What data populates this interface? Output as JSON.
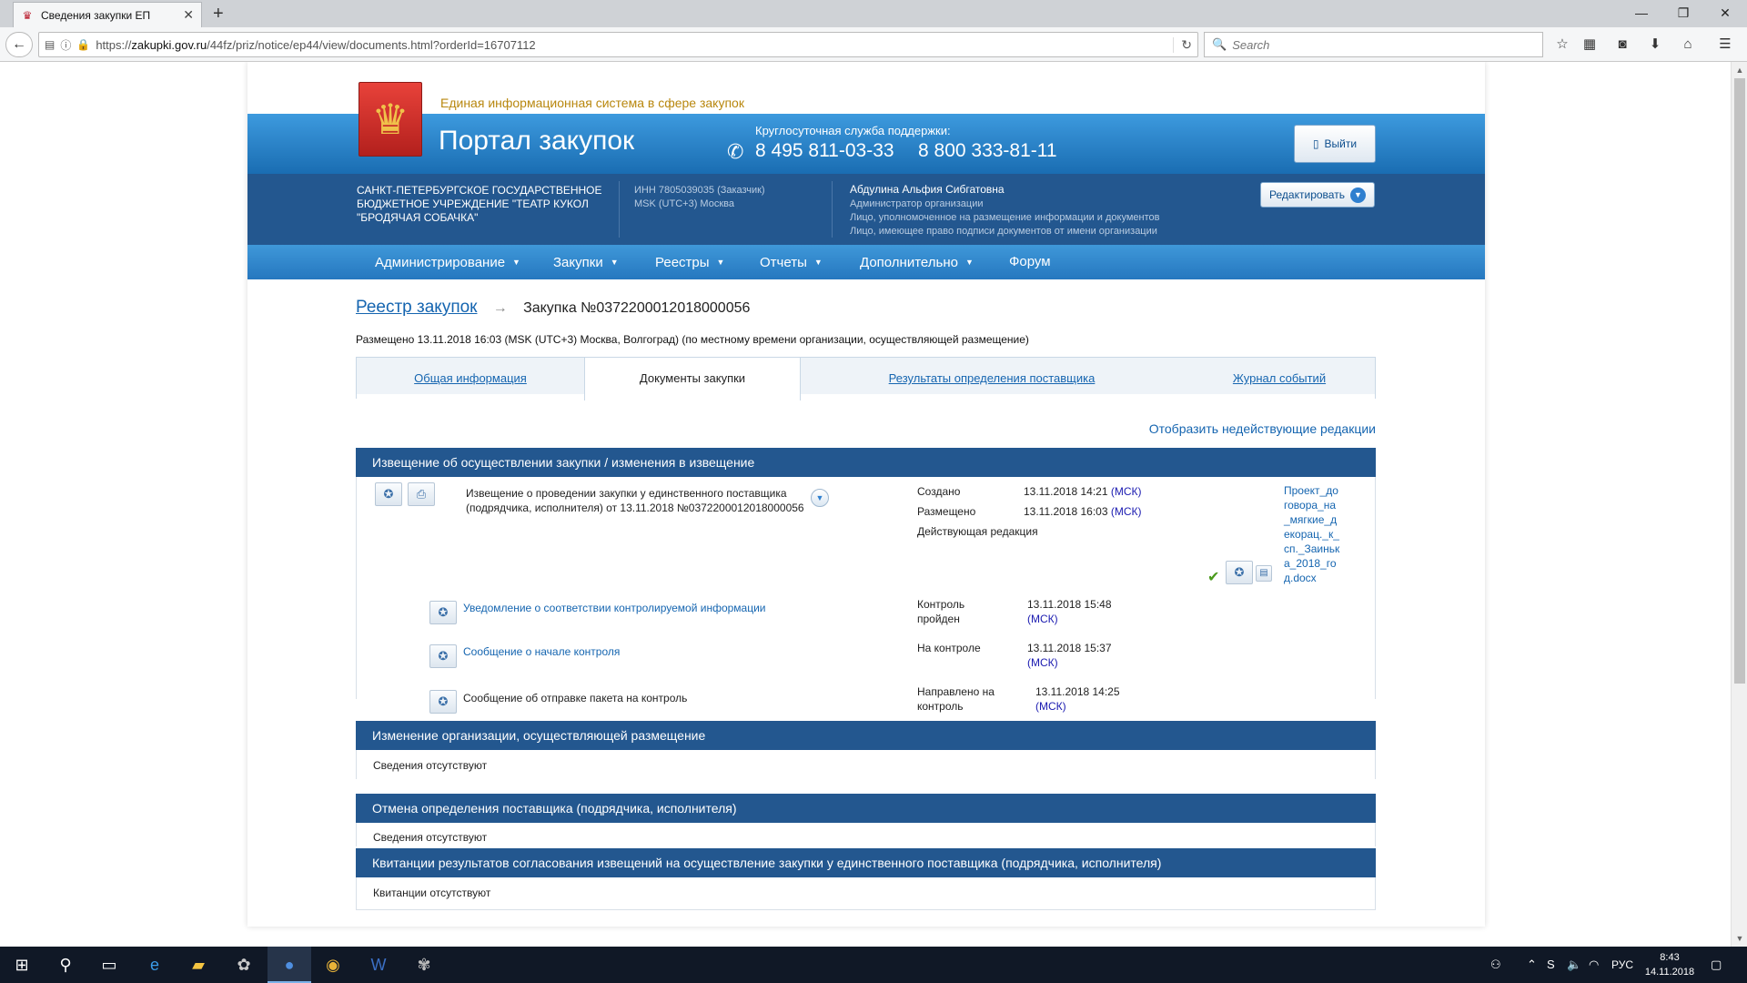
{
  "browser": {
    "tab_title": "Сведения закупки ЕП",
    "url_prefix": "https://",
    "url_host": "zakupki.gov.ru",
    "url_path": "/44fz/priz/notice/ep44/view/documents.html?orderId=16707112",
    "search_placeholder": "Search"
  },
  "header": {
    "tagline": "Единая информационная система в сфере закупок",
    "portal_title": "Портал закупок",
    "support_label": "Круглосуточная служба поддержки:",
    "phone1": "8 495 811-03-33",
    "phone2": "8 800 333-81-11",
    "logout_label": "Выйти"
  },
  "org": {
    "name": "Санкт-Петербургское государственное бюджетное учреждение \"Театр кукол \"Бродячая собачка\"",
    "inn": "ИНН 7805039035 (Заказчик)",
    "tz": "MSK (UTC+3) Москва",
    "user_name": "Абдулина Альфия Сибгатовна",
    "roles": [
      "Администратор организации",
      "Лицо, уполномоченное на размещение информации и документов",
      "Лицо, имеющее право подписи документов от имени организации"
    ],
    "edit_label": "Редактировать"
  },
  "menu": [
    "Администрирование",
    "Закупки",
    "Реестры",
    "Отчеты",
    "Дополнительно",
    "Форум"
  ],
  "breadcrumb": {
    "registry": "Реестр закупок",
    "current": "Закупка №0372200012018000056"
  },
  "placed_text": "Размещено 13.11.2018 16:03 (MSK (UTC+3) Москва, Волгоград) (по местному времени организации, осуществляющей размещение)",
  "tabs": [
    "Общая информация",
    "Документы закупки",
    "Результаты определения поставщика",
    "Журнал событий"
  ],
  "show_inactive": "Отобразить недействующие редакции",
  "sections": {
    "notice": {
      "title": "Извещение об осуществлении закупки / изменения в извещение",
      "doc_title": "Извещение о проведении закупки у единственного поставщика (подрядчика, исполнителя) от 13.11.2018 №0372200012018000056",
      "created_label": "Создано",
      "created_value": "13.11.2018 14:21",
      "placed_label": "Размещено",
      "placed_value": "13.11.2018 16:03",
      "msk": "(МСК)",
      "current_edition": "Действующая редакция",
      "file_name": "Проект_договора_на_мягкие_декорац._к_сп._Заинька_2018_год.docx",
      "control": [
        {
          "text": "Уведомление о соответствии контролируемой информации",
          "link": true,
          "label": "Контроль пройден",
          "value": "13.11.2018 15:48"
        },
        {
          "text": "Сообщение о начале контроля",
          "link": true,
          "label": "На контроле",
          "value": "13.11.2018 15:37"
        },
        {
          "text": "Сообщение об отправке пакета на контроль",
          "link": false,
          "label": "Направлено на контроль",
          "value": "13.11.2018 14:25"
        }
      ]
    },
    "org_change": {
      "title": "Изменение организации, осуществляющей размещение",
      "empty": "Сведения отсутствуют"
    },
    "cancel": {
      "title": "Отмена определения поставщика (подрядчика, исполнителя)",
      "empty": "Сведения отсутствуют"
    },
    "receipts": {
      "title": "Квитанции результатов согласования извещений на осуществление закупки у единственного поставщика (подрядчика, исполнителя)",
      "empty": "Квитанции отсутствуют"
    }
  },
  "taskbar": {
    "lang": "РУС",
    "time": "8:43",
    "date": "14.11.2018"
  }
}
